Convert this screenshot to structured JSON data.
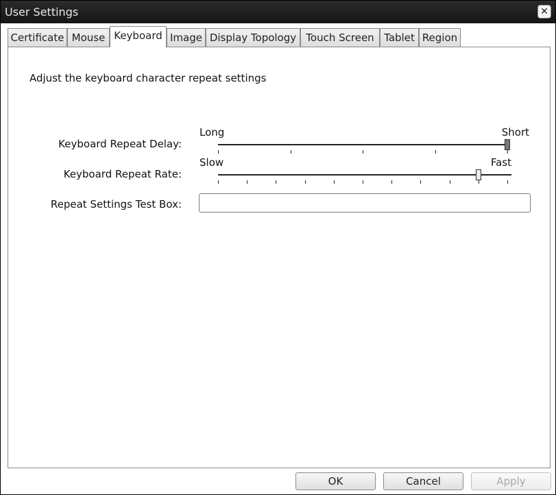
{
  "window": {
    "title": "User Settings",
    "close_glyph": "✕"
  },
  "tabs": [
    {
      "label": "Certificate",
      "active": false
    },
    {
      "label": "Mouse",
      "active": false
    },
    {
      "label": "Keyboard",
      "active": true
    },
    {
      "label": "Image",
      "active": false
    },
    {
      "label": "Display Topology",
      "active": false
    },
    {
      "label": "Touch Screen",
      "active": false
    },
    {
      "label": "Tablet",
      "active": false
    },
    {
      "label": "Region",
      "active": false
    }
  ],
  "keyboard": {
    "description": "Adjust the keyboard character repeat settings",
    "repeat_delay": {
      "label": "Keyboard Repeat Delay:",
      "min_label": "Long",
      "max_label": "Short",
      "tick_count": 5,
      "value_fraction": 1.0
    },
    "repeat_rate": {
      "label": "Keyboard Repeat Rate:",
      "min_label": "Slow",
      "max_label": "Fast",
      "tick_count": 11,
      "value_fraction": 0.9
    },
    "test_box": {
      "label": "Repeat Settings Test Box:",
      "value": ""
    }
  },
  "buttons": {
    "ok": "OK",
    "cancel": "Cancel",
    "apply": "Apply"
  },
  "colors": {
    "titlebar": "#1e1e1e",
    "delay_thumb": "#777777",
    "rate_thumb": "#e8e8e8"
  }
}
